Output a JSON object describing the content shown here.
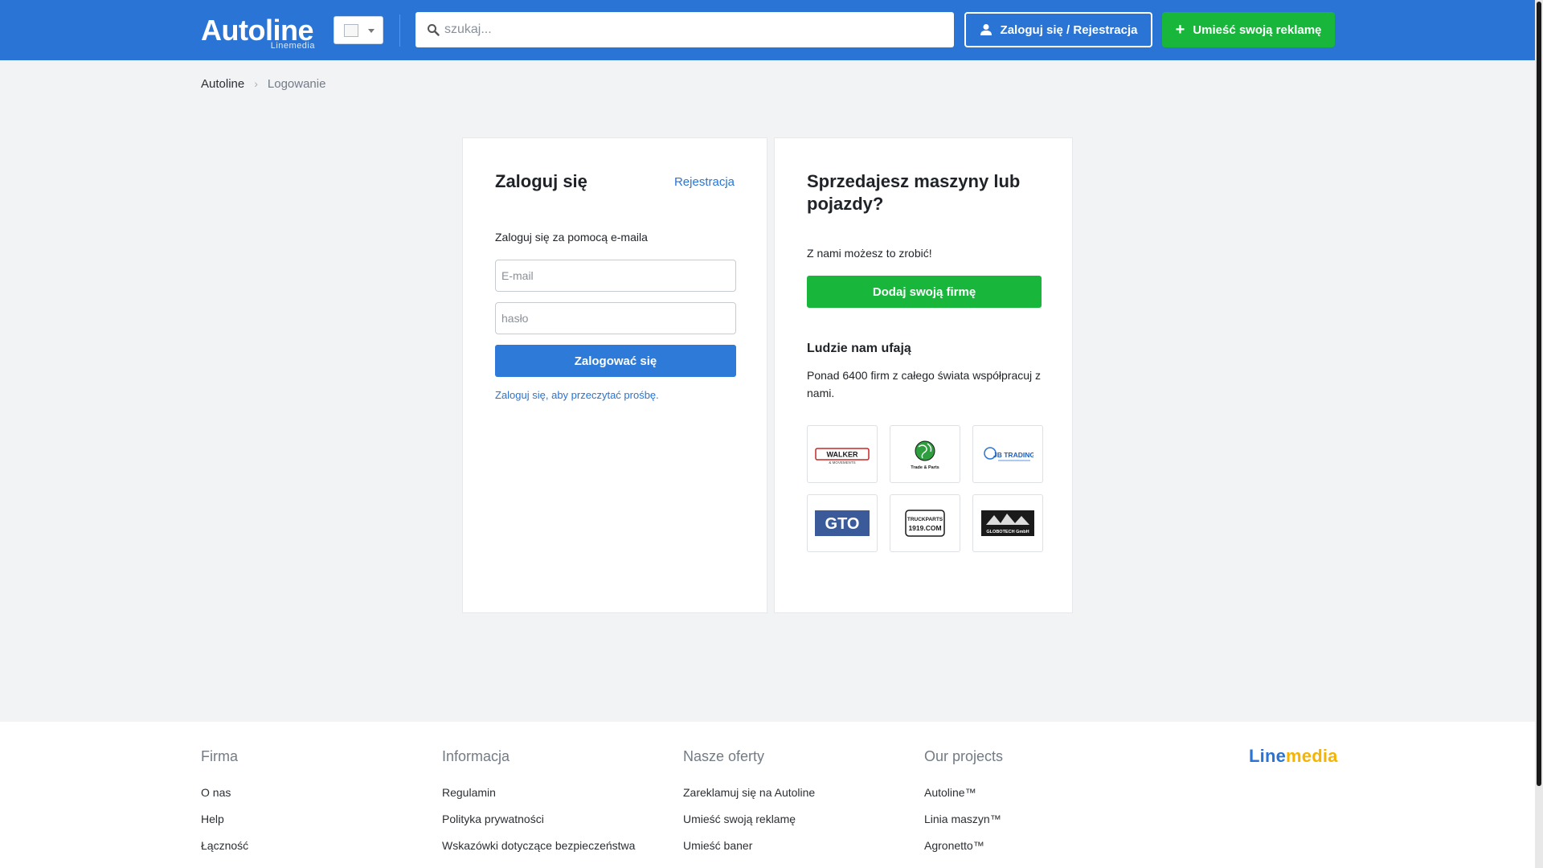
{
  "header": {
    "logo_text": "Autoline",
    "logo_sub": "Linemedia",
    "search_placeholder": "szukaj...",
    "login_button": "Zaloguj się / Rejestracja",
    "post_ad_button": "Umieść swoją reklamę",
    "accent_color": "#2974d4",
    "green_color": "#18b73c"
  },
  "breadcrumb": {
    "home": "Autoline",
    "current": "Logowanie"
  },
  "login": {
    "title": "Zaloguj się",
    "register_link": "Rejestracja",
    "subtitle": "Zaloguj się za pomocą e-maila",
    "email_placeholder": "E-mail",
    "password_placeholder": "hasło",
    "submit_button": "Zalogować się",
    "request_link": "Zaloguj się, aby przeczytać prośbę."
  },
  "seller": {
    "title": "Sprzedajesz maszyny lub pojazdy?",
    "text": "Z nami możesz to zrobić!",
    "add_company_button": "Dodaj swoją firmę",
    "trust_title": "Ludzie nam ufają",
    "trust_text": "Ponad 6400 firm z całego świata współpracuj z nami.",
    "partners": [
      {
        "text": "WALKER",
        "subtext": "& MOVEMENTS",
        "icon": "walker-logo"
      },
      {
        "text": "Trade & Parts",
        "subtext": "",
        "icon": "globe-logo"
      },
      {
        "text": "JB TRADING",
        "subtext": "",
        "icon": "jb-trading-logo"
      },
      {
        "text": "GTO",
        "subtext": "",
        "icon": "gto-logo"
      },
      {
        "text": "TRUCKPARTS",
        "subtext": "1919.COM",
        "icon": "truckparts-logo"
      },
      {
        "text": "GLOBOTECH GmbH",
        "subtext": "",
        "icon": "globotech-logo"
      }
    ]
  },
  "footer": {
    "columns": [
      {
        "heading": "Firma",
        "links": [
          "O nas",
          "Help",
          "Łączność"
        ]
      },
      {
        "heading": "Informacja",
        "links": [
          "Regulamin",
          "Polityka prywatności",
          "Wskazówki dotyczące bezpieczeństwa"
        ]
      },
      {
        "heading": "Nasze oferty",
        "links": [
          "Zareklamuj się na Autoline",
          "Umieść swoją reklamę",
          "Umieść baner"
        ]
      },
      {
        "heading": "Our projects",
        "links": [
          "Autoline™",
          "Linia maszyn™",
          "Agronetto™"
        ]
      }
    ],
    "brand_line": "Line",
    "brand_media": "media"
  }
}
